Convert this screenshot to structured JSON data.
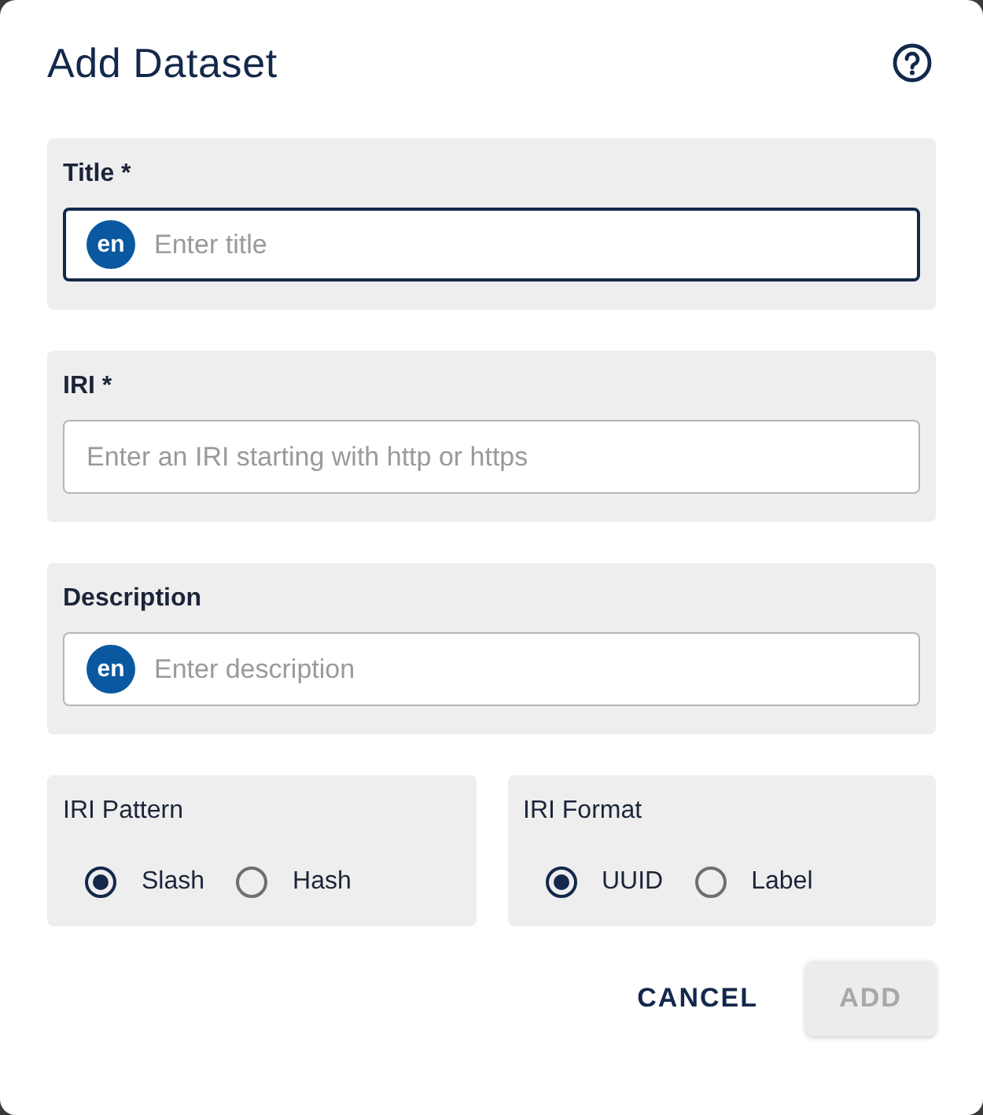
{
  "dialog": {
    "title": "Add Dataset"
  },
  "fields": [
    {
      "label": "Title *",
      "language": "en",
      "placeholder": "Enter title",
      "focused": true
    },
    {
      "label": "IRI *",
      "placeholder": "Enter an IRI starting with http or https",
      "focused": false
    },
    {
      "label": "Description",
      "language": "en",
      "placeholder": "Enter description",
      "focused": false
    }
  ],
  "option_groups": [
    {
      "label": "IRI Pattern",
      "options": [
        {
          "label": "Slash",
          "selected": true
        },
        {
          "label": "Hash",
          "selected": false
        }
      ]
    },
    {
      "label": "IRI Format",
      "options": [
        {
          "label": "UUID",
          "selected": true
        },
        {
          "label": "Label",
          "selected": false
        }
      ]
    }
  ],
  "buttons": [
    {
      "label": "CANCEL",
      "disabled": false
    },
    {
      "label": "ADD",
      "disabled": true
    }
  ]
}
